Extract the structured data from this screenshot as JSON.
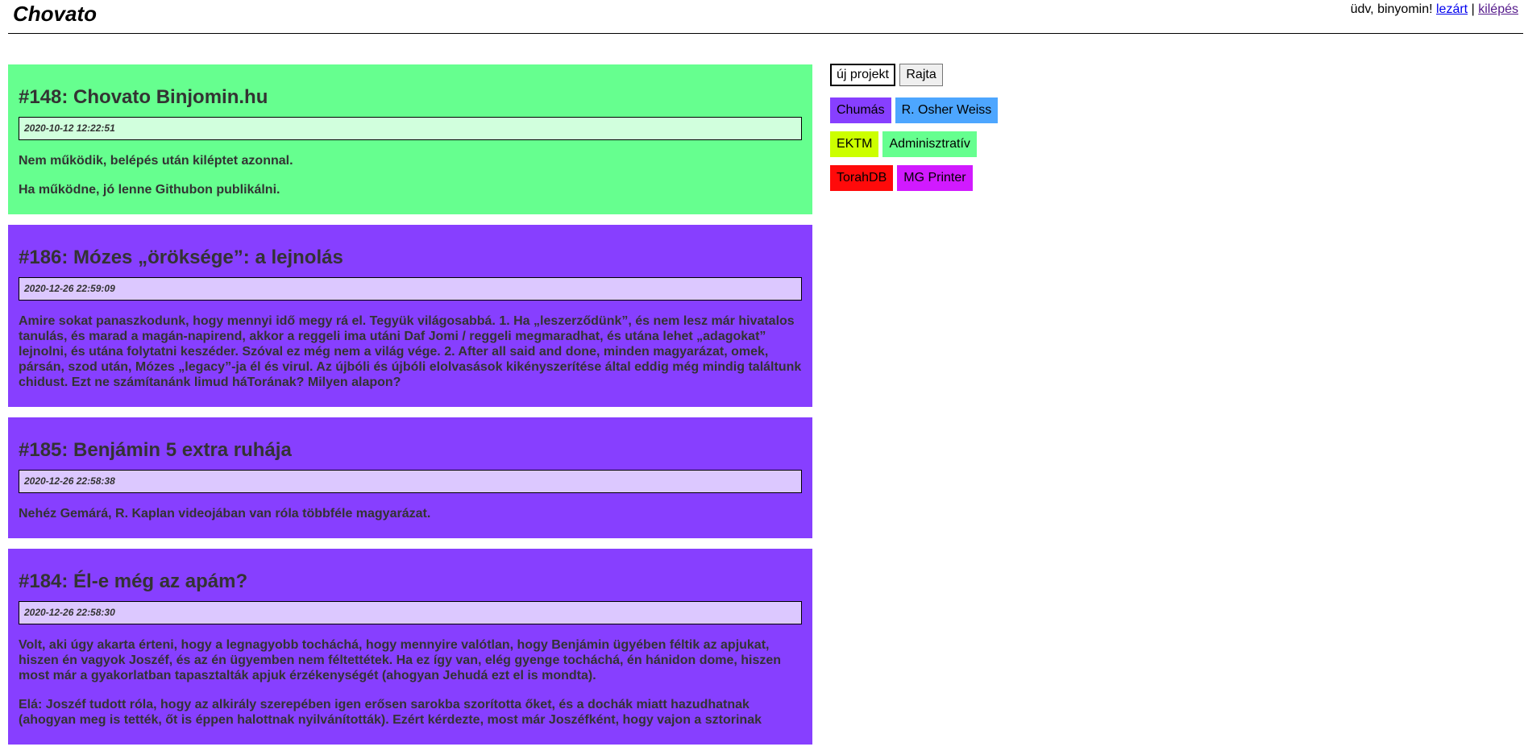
{
  "header": {
    "brand": "Chovato",
    "greeting": "üdv, binyomin!",
    "closed_link": "lezárt",
    "separator": "|",
    "logout_link": "kilépés"
  },
  "issues": [
    {
      "title": "#148: Chovato Binjomin.hu",
      "date": "2020-10-12 12:22:51",
      "color": "#66ff8f",
      "paragraphs": [
        "Nem működik, belépés után kiléptet azonnal.",
        "Ha működne, jó lenne Githubon publikálni."
      ]
    },
    {
      "title": "#186: Mózes „öröksége”: a lejnolás",
      "date": "2020-12-26 22:59:09",
      "color": "#873fff",
      "paragraphs": [
        "Amire sokat panaszkodunk, hogy mennyi idő megy rá el. Tegyük világosabbá. 1. Ha „leszerződünk”, és nem lesz már hivatalos tanulás, és marad a magán-napirend, akkor a reggeli ima utáni Daf Jomi / reggeli megmaradhat, és utána lehet „adagokat” lejnolni, és utána folytatni keszéder. Szóval ez még nem a világ vége. 2. After all said and done, minden magyarázat, omek, pársán, szod után, Mózes „legacy”-ja él és virul. Az újbóli és újbóli elolvasások kikényszerítése által eddig még mindig találtunk chidust. Ezt ne számítanánk limud háTorának? Milyen alapon?"
      ]
    },
    {
      "title": "#185: Benjámin 5 extra ruhája",
      "date": "2020-12-26 22:58:38",
      "color": "#873fff",
      "paragraphs": [
        "Nehéz Gemárá, R. Kaplan videojában van róla többféle magyarázat."
      ]
    },
    {
      "title": "#184: Él-e még az apám?",
      "date": "2020-12-26 22:58:30",
      "color": "#873fff",
      "paragraphs": [
        "Volt, aki úgy akarta érteni, hogy a legnagyobb tocháchá, hogy mennyire valótlan, hogy Benjámin ügyében féltik az apjukat, hiszen én vagyok Joszéf, és az én ügyemben nem féltettétek. Ha ez így van, elég gyenge tocháchá, én hánidon dome, hiszen most már a gyakorlatban tapasztalták apjuk érzékenységét (ahogyan Jehudá ezt el is mondta).",
        "Elá: Joszéf tudott róla, hogy az alkirály szerepében igen erősen sarokba szorította őket, és a dochák miatt hazudhatnak (ahogyan meg is tették, őt is éppen halottnak nyilvánították). Ezért kérdezte, most már Joszéfként, hogy vajon a sztorinak"
      ]
    }
  ],
  "sidebar": {
    "buttons": {
      "new_project": "új projekt",
      "go": "Rajta"
    },
    "tags": [
      {
        "label": "Chumás",
        "color": "#873fff"
      },
      {
        "label": "R. Osher Weiss",
        "color": "#4da6ff"
      },
      {
        "label": "EKTM",
        "color": "#ccff00"
      },
      {
        "label": "Adminisztratív",
        "color": "#66ff8f"
      },
      {
        "label": "TorahDB",
        "color": "#ff0a0a"
      },
      {
        "label": "MG Printer",
        "color": "#d11aff"
      }
    ]
  }
}
